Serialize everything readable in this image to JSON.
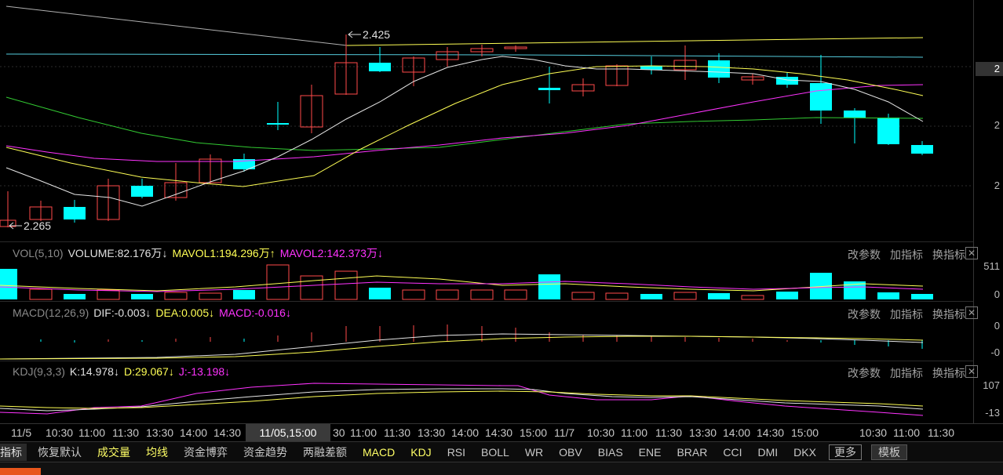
{
  "price_panel": {
    "high_label": "2.425",
    "low_label": "2.265",
    "y_labels": [
      "2",
      "2",
      "2",
      "2"
    ],
    "y_highlight": "2"
  },
  "vol_panel": {
    "name": "VOL(5,10)",
    "volume": "VOLUME:82.176万",
    "mavol1": "MAVOL1:194.296万",
    "mavol2": "MAVOL2:142.373万",
    "y_labels": [
      "511",
      "0"
    ]
  },
  "macd_panel": {
    "name": "MACD(12,26,9)",
    "dif": "DIF:-0.003",
    "dea": "DEA:0.005",
    "macd": "MACD:-0.016",
    "y_labels": [
      "0",
      "-0"
    ]
  },
  "kdj_panel": {
    "name": "KDJ(9,3,3)",
    "k": "K:14.978",
    "d": "D:29.067",
    "j": "J:-13.198",
    "y_labels": [
      "107",
      "-13"
    ]
  },
  "panel_tools": {
    "change_params": "改参数",
    "add_indicator": "加指标",
    "switch_indicator": "换指标",
    "close": "✕"
  },
  "arrows": {
    "down": "↓",
    "up": "↑"
  },
  "time_axis": {
    "labels": [
      "11/5",
      "10:30",
      "11:00",
      "11:30",
      "13:30",
      "14:00",
      "14:30",
      "11:00",
      "11:30",
      "13:30",
      "14:00",
      "14:30",
      "15:00",
      "11/7",
      "10:30",
      "11:00",
      "11:30",
      "13:30",
      "14:00",
      "14:30",
      "15:00",
      "10:30",
      "11:00",
      "11:30"
    ],
    "cursor": "11/05,15:00",
    "cursor_partial": "30"
  },
  "tabs": [
    "指标",
    "恢复默认",
    "成交量",
    "均线",
    "资金博弈",
    "资金趋势",
    "两融差额",
    "MACD",
    "KDJ",
    "RSI",
    "BOLL",
    "WR",
    "OBV",
    "BIAS",
    "ENE",
    "BRAR",
    "CCI",
    "DMI",
    "DKX"
  ],
  "more_label": "更多",
  "template_label": "模板",
  "colors": {
    "up": "#ff4a4a",
    "down": "#00ffff",
    "white_line": "#e6e6e6",
    "yellow_line": "#ffff55",
    "magenta_line": "#ff33ff",
    "green_line": "#33cc33"
  }
}
